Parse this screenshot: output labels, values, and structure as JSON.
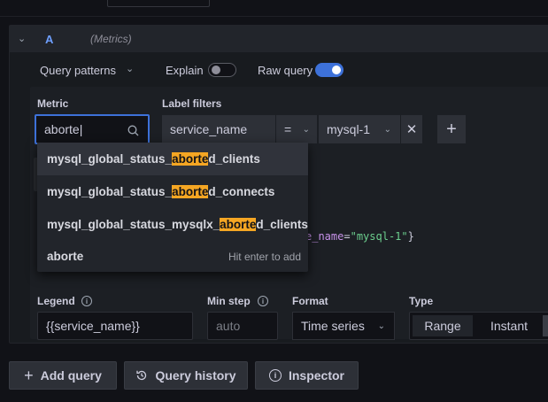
{
  "query": {
    "letter": "A",
    "datasource": "(Metrics)"
  },
  "options": {
    "query_patterns": "Query patterns",
    "explain": "Explain",
    "raw_query": "Raw query",
    "explain_on": false,
    "raw_query_on": true
  },
  "metric": {
    "label": "Metric",
    "value": "aborte"
  },
  "label_filters": {
    "label": "Label filters",
    "key": "service_name",
    "operator": "=",
    "value": "mysql-1"
  },
  "suggestions": [
    {
      "prefix": "mysql_global_status_",
      "match": "aborte",
      "suffix": "d_clients"
    },
    {
      "prefix": "mysql_global_status_",
      "match": "aborte",
      "suffix": "d_connects"
    },
    {
      "prefix": "mysql_global_status_mysqlx_",
      "match": "aborte",
      "suffix": "d_clients"
    },
    {
      "prefix": "aborte",
      "match": "",
      "suffix": "",
      "hint": "Hit enter to add"
    }
  ],
  "raw_query_fragment": {
    "key_tail": "e_name",
    "eq": "=",
    "value": "\"mysql-1\"",
    "close": "}"
  },
  "legend": {
    "label": "Legend",
    "value": "{{service_name}}"
  },
  "min_step": {
    "label": "Min step",
    "placeholder": "auto"
  },
  "format": {
    "label": "Format",
    "value": "Time series"
  },
  "type": {
    "label": "Type",
    "options": [
      "Range",
      "Instant"
    ]
  },
  "actions": {
    "add_query": "Add query",
    "query_history": "Query history",
    "inspector": "Inspector"
  },
  "colors": {
    "accent": "#3d71d9",
    "highlight": "#f5a623",
    "code_green": "#6ccf8e",
    "code_purple": "#c792ea"
  }
}
